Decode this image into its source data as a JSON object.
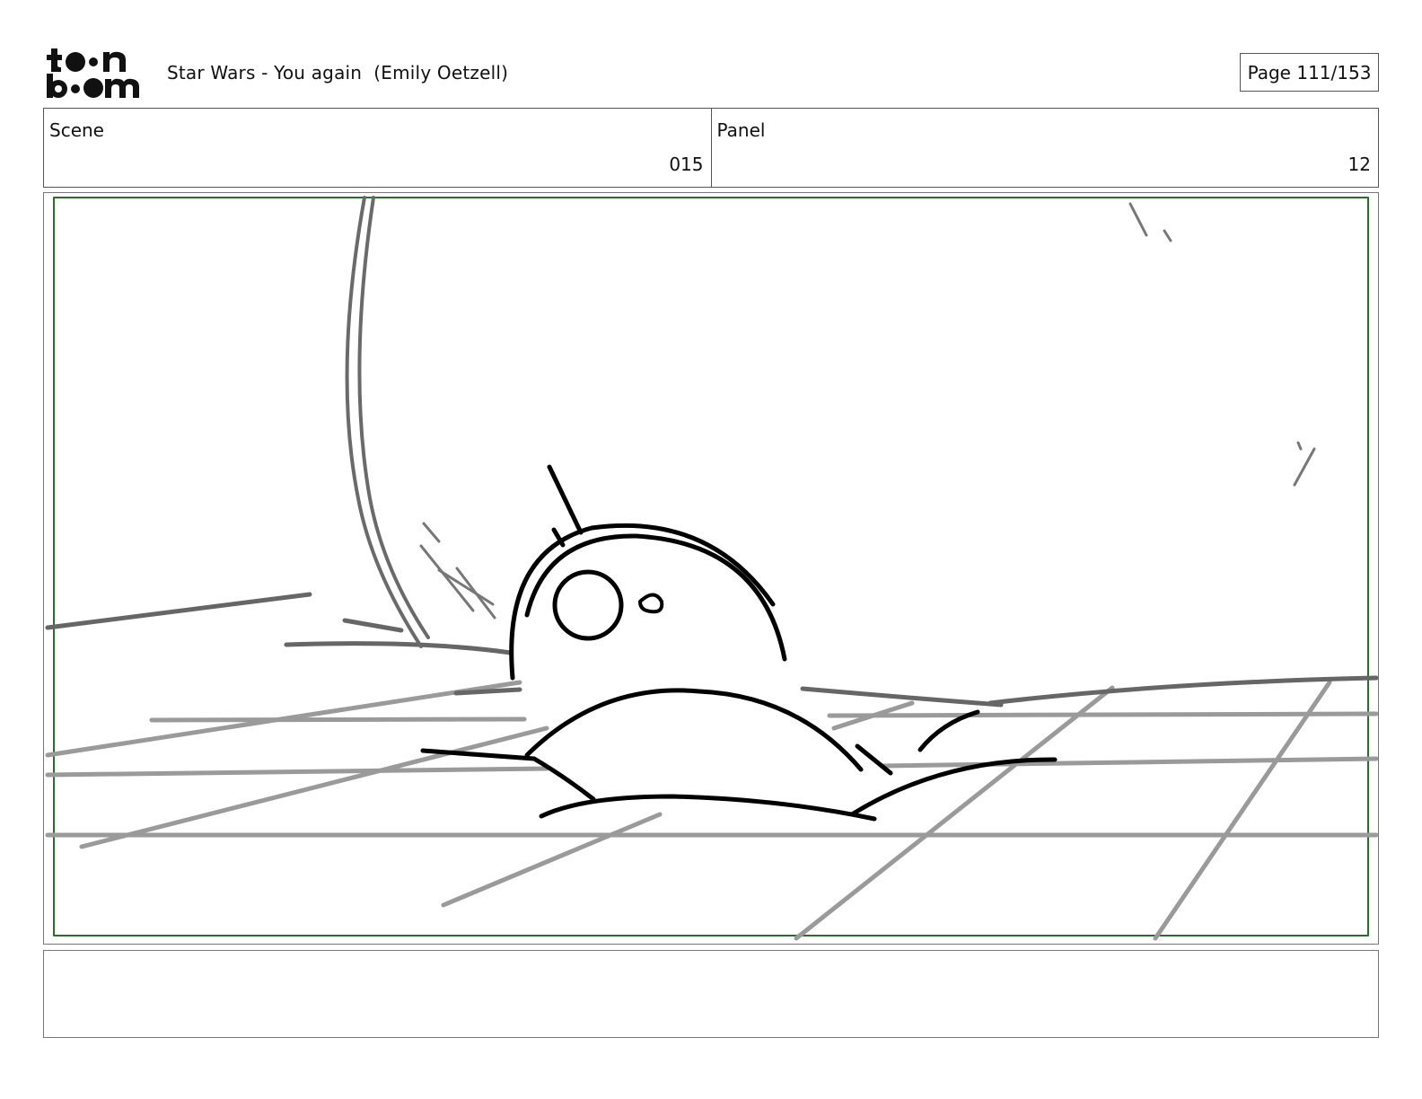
{
  "header": {
    "logo_text": "toon boom",
    "title": "Star Wars - You again  (Emily Oetzell)",
    "page": "Page 111/153"
  },
  "scene": {
    "label": "Scene",
    "value": "015"
  },
  "panel": {
    "label": "Panel",
    "value": "12"
  },
  "notes": {
    "text": ""
  },
  "colors": {
    "safe_frame": "#2e6b2e",
    "ink": "#000000",
    "dark_pencil": "#666666",
    "light_pencil": "#9a9a9a",
    "border": "#555555"
  }
}
